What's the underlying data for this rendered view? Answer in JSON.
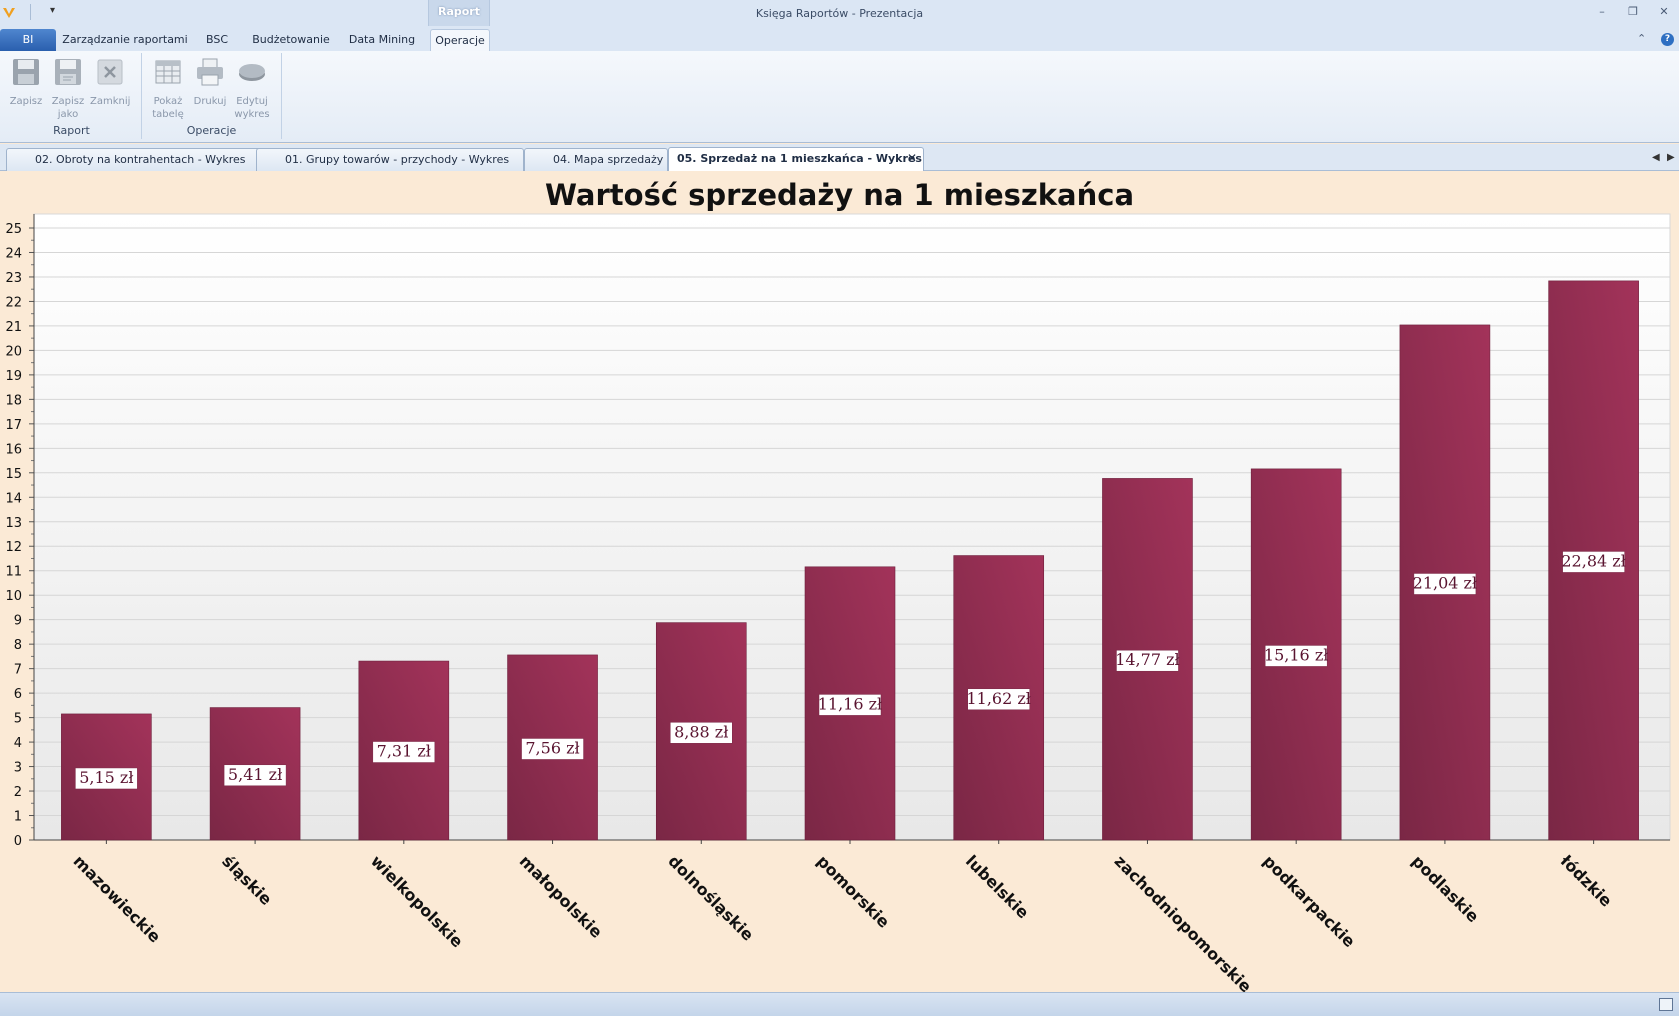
{
  "window": {
    "title": "Księga Raportów - Prezentacja",
    "context_tab": "Raport",
    "qat_dropdown": "▾",
    "controls": {
      "minimize": "–",
      "restore": "❐",
      "close": "✕"
    }
  },
  "ribbon": {
    "tabs": [
      {
        "label": "BI"
      },
      {
        "label": "Zarządzanie raportami"
      },
      {
        "label": "BSC"
      },
      {
        "label": "Budżetowanie"
      },
      {
        "label": "Data Mining"
      },
      {
        "label": "Operacje"
      }
    ],
    "active_tab": "Operacje",
    "collapse_icon": "⌃",
    "help_icon": "?",
    "groups": [
      {
        "label": "Raport",
        "buttons": [
          {
            "label": "Zapisz",
            "icon": "save-icon"
          },
          {
            "label": "Zapisz\njako",
            "icon": "save-as-icon"
          },
          {
            "label": "Zamknij",
            "icon": "close-icon"
          }
        ]
      },
      {
        "label": "Operacje",
        "buttons": [
          {
            "label": "Pokaż\ntabelę",
            "icon": "table-icon"
          },
          {
            "label": "Drukuj",
            "icon": "printer-icon"
          },
          {
            "label": "Edytuj\nwykres",
            "icon": "pie-chart-icon"
          }
        ]
      }
    ]
  },
  "document_tabs": [
    {
      "label": "02. Obroty na kontrahentach - Wykres"
    },
    {
      "label": "01. Grupy towarów - przychody - Wykres"
    },
    {
      "label": "04. Mapa sprzedaży"
    },
    {
      "label": "05. Sprzedaż na 1 mieszkańca - Wykres",
      "active": true
    }
  ],
  "nav_arrows": {
    "left": "◀",
    "right": "▶"
  },
  "tab_close": "✕",
  "chart_data": {
    "type": "bar",
    "title": "Wartość sprzedaży na 1 mieszkańca",
    "xlabel": "",
    "ylabel": "",
    "ylim": [
      0,
      25
    ],
    "yticks": [
      0,
      1,
      2,
      3,
      4,
      5,
      6,
      7,
      8,
      9,
      10,
      11,
      12,
      13,
      14,
      15,
      16,
      17,
      18,
      19,
      20,
      21,
      22,
      23,
      24,
      25
    ],
    "grid": true,
    "bar_color": "#a3335a",
    "categories": [
      "mazowieckie",
      "śląskie",
      "wielkopolskie",
      "małopolskie",
      "dolnośląskie",
      "pomorskie",
      "lubelskie",
      "zachodniopomorskie",
      "podkarpackie",
      "podlaskie",
      "łódzkie"
    ],
    "values": [
      5.15,
      5.41,
      7.31,
      7.56,
      8.88,
      11.16,
      11.62,
      14.77,
      15.16,
      21.04,
      22.84
    ],
    "data_labels": [
      "5,15 zł",
      "5,41 zł",
      "7,31 zł",
      "7,56 zł",
      "8,88 zł",
      "11,16 zł",
      "11,62 zł",
      "14,77 zł",
      "15,16 zł",
      "21,04 zł",
      "22,84 zł"
    ]
  }
}
